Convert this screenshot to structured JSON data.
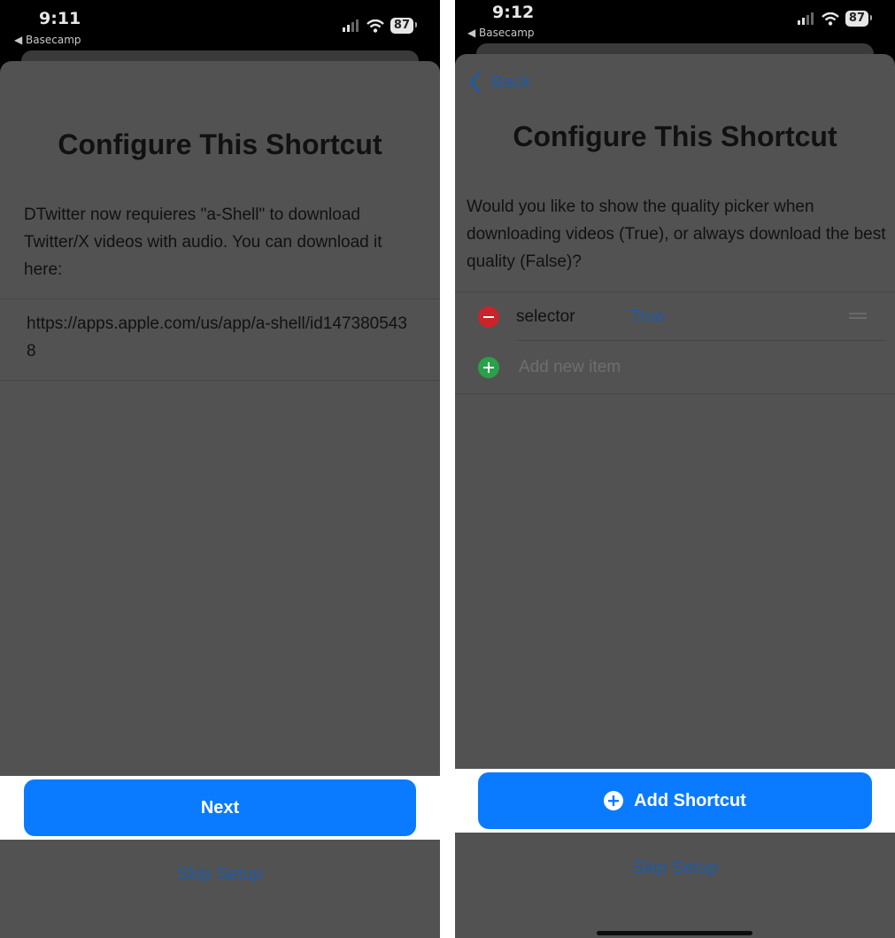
{
  "left": {
    "status": {
      "time": "9:11",
      "back_app": "◀ Basecamp",
      "battery": "87"
    },
    "title": "Configure This Shortcut",
    "description": "DTwitter now requieres \"a-Shell\" to download Twitter/X videos with audio. You can download it here:",
    "url": "https://apps.apple.com/us/app/a-shell/id1473805438",
    "next_label": "Next",
    "skip_label": "Skip Setup"
  },
  "right": {
    "status": {
      "time": "9:12",
      "back_app": "◀ Basecamp",
      "battery": "87"
    },
    "back_label": "Back",
    "title": "Configure This Shortcut",
    "question": "Would you like to show the quality picker when downloading videos (True), or always download the best quality (False)?",
    "item": {
      "key": "selector",
      "value": "True"
    },
    "add_item_placeholder": "Add new item",
    "add_shortcut_label": "Add Shortcut",
    "skip_label": "Skip Setup"
  },
  "colors": {
    "accent": "#0a7bff",
    "link": "#1f5aa3",
    "sheet": "#525252",
    "delete": "#c8242a",
    "add": "#2aa04a"
  },
  "icons": [
    "signal-icon",
    "wifi-icon",
    "battery-icon",
    "chevron-left-icon",
    "minus-circle-icon",
    "plus-circle-icon",
    "reorder-icon"
  ]
}
